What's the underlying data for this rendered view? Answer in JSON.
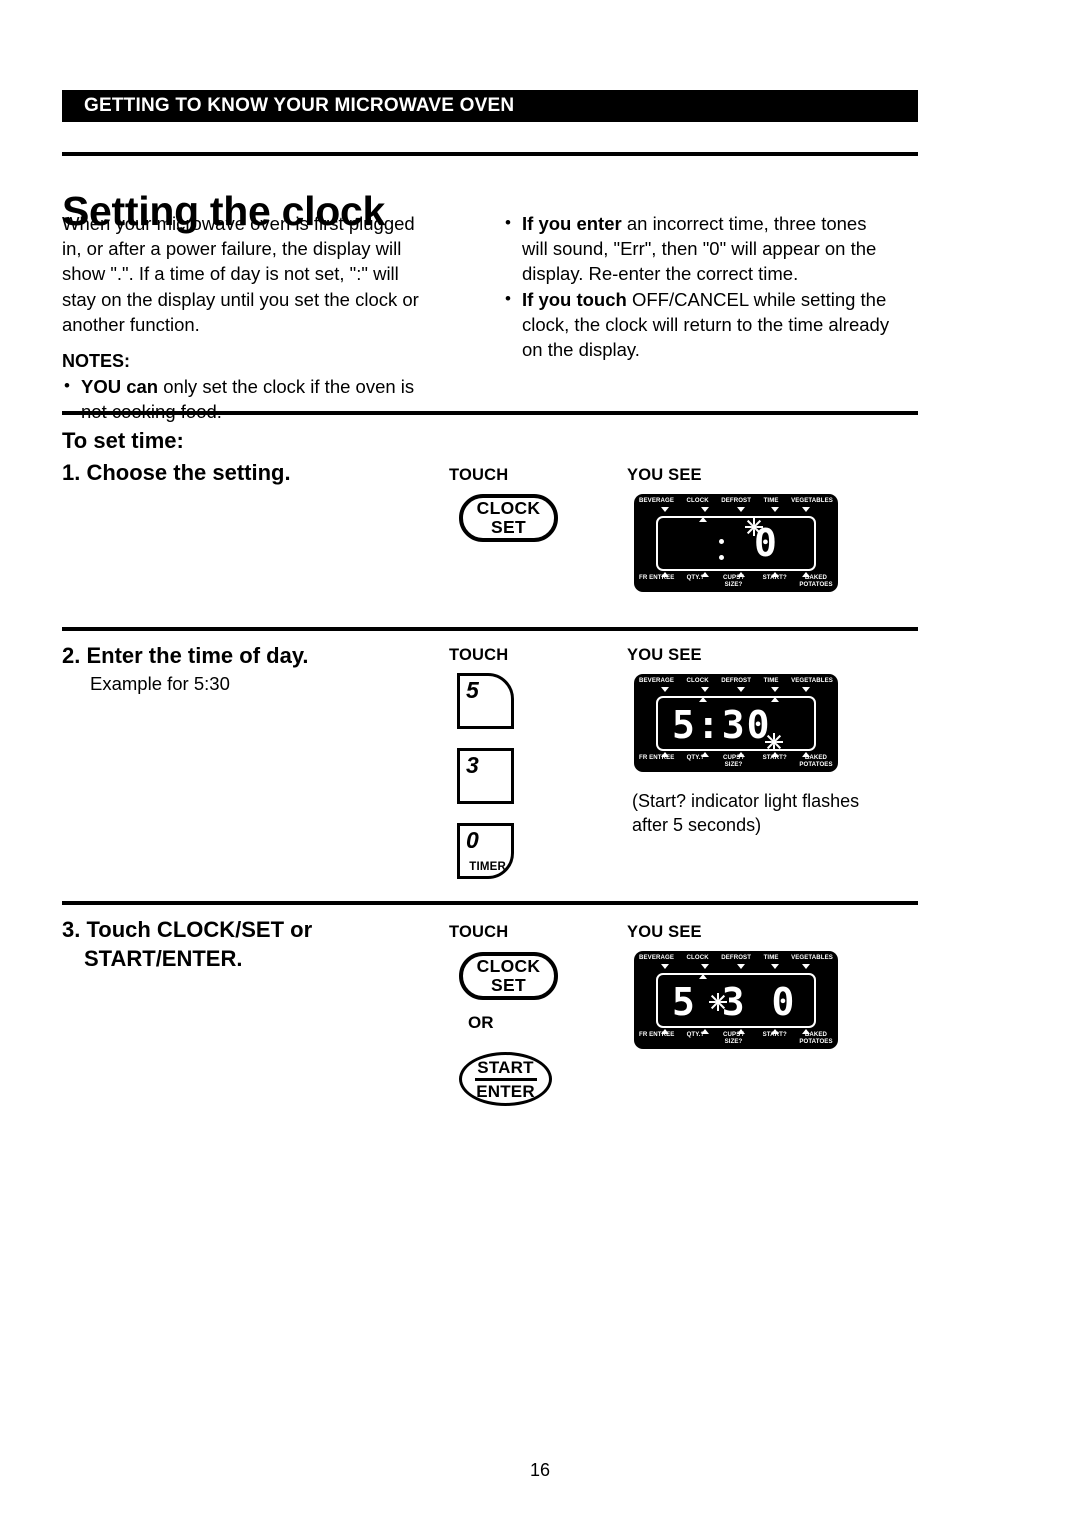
{
  "header": {
    "banner_title": "GETTING TO KNOW YOUR MICROWAVE OVEN"
  },
  "page_title": "Setting the clock",
  "intro": {
    "left_paragraph": "When your microwave oven is first plugged in, or after a power failure, the display will show \".\". If a time of day is not set, \":\" will stay on the display until you set the clock or another function.",
    "notes_heading": "NOTES:",
    "notes": [
      {
        "bold": "YOU can",
        "rest": " only set the clock if the oven is not cooking food."
      }
    ],
    "right_bullets": [
      {
        "bold": "If you enter",
        "rest": " an incorrect time, three tones will sound, \"Err\", then \"0\" will appear on the display. Re-enter the correct time."
      },
      {
        "bold": "If you touch",
        "rest": " OFF/CANCEL while setting the clock, the clock will return to the time already on the display."
      }
    ]
  },
  "procedure": {
    "intro_label": "To set time:",
    "column_headers": {
      "touch": "TOUCH",
      "you_see": "YOU SEE"
    },
    "steps": [
      {
        "heading": "1. Choose the setting.",
        "touch_buttons": [
          {
            "type": "pill",
            "line1": "CLOCK",
            "line2": "SET"
          }
        ],
        "display": {
          "top_labels": [
            "BEVERAGE",
            "CLOCK",
            "DEFROST",
            "TIME",
            "VEGETABLES"
          ],
          "bottom_labels": [
            "FR ENTREE",
            "QTY.?",
            "CUPS / SIZE?",
            "START?",
            "BAKED POTATOES"
          ],
          "readout": ":0",
          "flashing": true
        }
      },
      {
        "heading": "2. Enter the time of day.",
        "subtext": "Example for 5:30",
        "touch_buttons": [
          {
            "type": "key",
            "num": "5",
            "sub": ""
          },
          {
            "type": "key",
            "num": "3",
            "sub": ""
          },
          {
            "type": "key",
            "num": "0",
            "sub": "TIMER"
          }
        ],
        "display": {
          "top_labels": [
            "BEVERAGE",
            "CLOCK",
            "DEFROST",
            "TIME",
            "VEGETABLES"
          ],
          "bottom_labels": [
            "FR ENTREE",
            "QTY.?",
            "CUPS / SIZE?",
            "START?",
            "BAKED POTATOES"
          ],
          "readout": "5:30",
          "flashing": true
        },
        "caption": "(Start? indicator light flashes after 5 seconds)"
      },
      {
        "heading_line1": "3. Touch CLOCK/SET or",
        "heading_line2": "START/ENTER.",
        "or_label": "OR",
        "touch_buttons": [
          {
            "type": "pill",
            "line1": "CLOCK",
            "line2": "SET"
          },
          {
            "type": "oval",
            "line1": "START",
            "line2": "ENTER"
          }
        ],
        "display": {
          "top_labels": [
            "BEVERAGE",
            "CLOCK",
            "DEFROST",
            "TIME",
            "VEGETABLES"
          ],
          "bottom_labels": [
            "FR ENTREE",
            "QTY.?",
            "CUPS / SIZE?",
            "START?",
            "BAKED POTATOES"
          ],
          "readout": "5 3 0",
          "flashing": true
        }
      }
    ]
  },
  "footer": {
    "page_number": "16"
  },
  "colors": {
    "banner_bg": "#000000",
    "banner_text": "#ffffff",
    "page_bg": "#ffffff",
    "display_bg": "#000000",
    "display_text": "#ffffff"
  }
}
